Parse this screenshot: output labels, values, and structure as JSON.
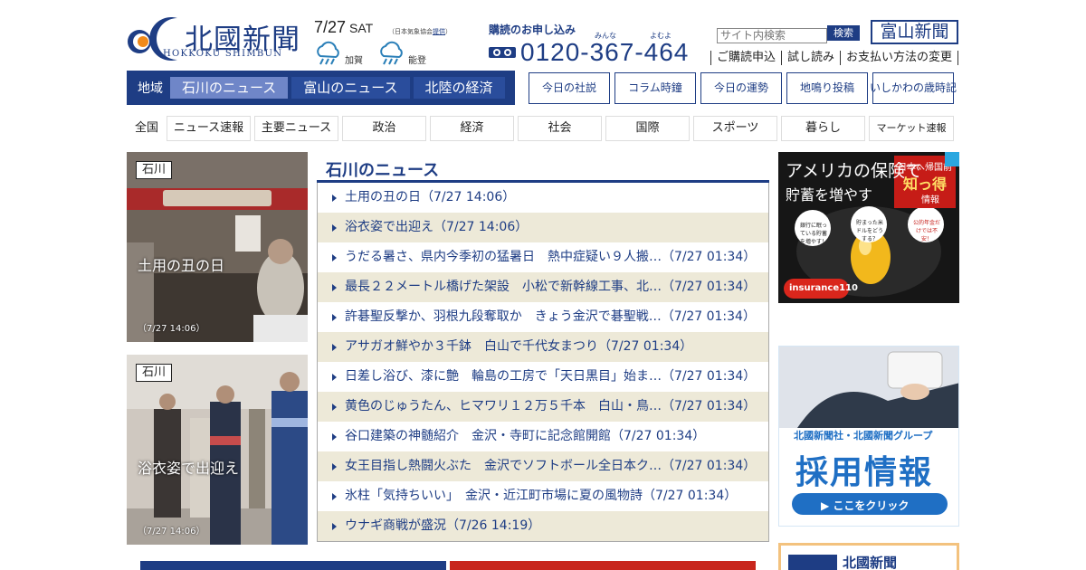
{
  "header": {
    "logo_title": "北國新聞",
    "logo_sub": "HOKKOKU SHIMBUN",
    "date": "7/27",
    "weekday": "SAT",
    "weather_note_prefix": "（日本気象協会",
    "weather_note_link": "提供",
    "weather_note_suffix": "）",
    "weather": [
      {
        "label": "加賀",
        "icon": "cloud-rain-icon"
      },
      {
        "label": "能登",
        "icon": "cloud-rain-icon"
      }
    ],
    "subscription_label": "購読のお申し込み",
    "subscription_ruby_1": "みんな",
    "subscription_ruby_2": "よむよ",
    "phone": "0120-367-464",
    "search_placeholder": "サイト内検索",
    "search_button": "検索",
    "toyama_button": "富山新聞",
    "top_links": [
      "ご購読申込",
      "試し読み",
      "お支払い方法の変更"
    ]
  },
  "region_nav": {
    "label": "地域",
    "tabs": [
      {
        "label": "石川のニュース",
        "active": true
      },
      {
        "label": "富山のニュース",
        "active": false
      },
      {
        "label": "北陸の経済",
        "active": false
      }
    ]
  },
  "feature_boxes": [
    "今日の社説",
    "コラム時鐘",
    "今日の運勢",
    "地鳴り投稿",
    "いしかわの",
    "歳時記"
  ],
  "category_nav": {
    "first": "全国",
    "items": [
      "ニュース速報",
      "主要ニュース",
      "政治",
      "経済",
      "社会",
      "国際",
      "スポーツ",
      "暮らし",
      "マーケット速報"
    ]
  },
  "photo_cards": [
    {
      "tag": "石川",
      "caption": "土用の丑の日",
      "time": "（7/27 14:06）"
    },
    {
      "tag": "石川",
      "caption": "浴衣姿で出迎え",
      "time": "（7/27 14:06）"
    }
  ],
  "main": {
    "title": "石川のニュース",
    "news": [
      "土用の丑の日（7/27 14:06）",
      "浴衣姿で出迎え（7/27 14:06）",
      "うだる暑さ、県内今季初の猛暑日　熱中症疑い９人搬…（7/27 01:34）",
      "最長２２メートル橋げた架設　小松で新幹線工事、北…（7/27 01:34）",
      "許碁聖反撃か、羽根九段奪取か　きょう金沢で碁聖戦…（7/27 01:34）",
      "アサガオ鮮やか３千鉢　白山で千代女まつり（7/27 01:34）",
      "日差し浴び、漆に艶　輪島の工房で「天日黒目」始ま…（7/27 01:34）",
      "黄色のじゅうたん、ヒマワリ１２万５千本　白山・鳥…（7/27 01:34）",
      "谷口建築の神髄紹介　金沢・寺町に記念館開館（7/27 01:34）",
      "女王目指し熱闘火ぶた　金沢でソフトボール全日本ク…（7/27 01:34）",
      "氷柱「気持ちいい」　金沢・近江町市場に夏の風物詩（7/27 01:34）",
      "ウナギ商戦が盛況（7/26 14:19）"
    ]
  },
  "ads": {
    "ad1_line1": "アメリカの保険で",
    "ad1_line2": "貯蓄を増やす",
    "ad1_badge_line1": "日本へ帰国前",
    "ad1_badge_line2": "知っ得",
    "ad1_badge_line3": "情報",
    "ad1_bubble1": "銀行に眠っている貯蓄を増やす！",
    "ad1_bubble2": "貯まった米ドルをどうする？",
    "ad1_bubble3": "公的年金だけでは不安！",
    "ad1_brand": "insurance110",
    "ad2_line1": "北國新聞社・北國新聞グループ",
    "ad2_line2": "採用情報",
    "ad2_button": "▶ ここをクリック",
    "ad3_title": "北國新聞"
  },
  "colors": {
    "brand": "#1e3d84",
    "active_tab": "#6f86c8",
    "stripe": "#ede9d8"
  }
}
